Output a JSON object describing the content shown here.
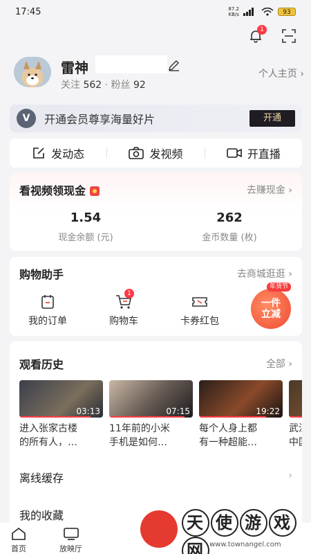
{
  "status": {
    "time": "17:45",
    "netspeed_value": "87.2",
    "netspeed_unit": "KB/s",
    "battery": "93"
  },
  "top": {
    "bell_badge": "1"
  },
  "profile": {
    "name": "雷神",
    "follow_label": "关注",
    "follow_count": "562",
    "fans_label": "粉丝",
    "fans_count": "92",
    "homepage_link": "个人主页 ›"
  },
  "vip": {
    "logo": "V",
    "text": "开通会员尊享海量好片",
    "button": "开通"
  },
  "actions": [
    {
      "label": "发动态",
      "icon": "edit-square-icon"
    },
    {
      "label": "发视频",
      "icon": "camera-icon"
    },
    {
      "label": "开直播",
      "icon": "video-camera-icon"
    }
  ],
  "cash": {
    "title": "看视频领现金",
    "link": "去赚现金 ›",
    "balance_value": "1.54",
    "balance_label": "现金余额 (元)",
    "coins_value": "262",
    "coins_label": "金币数量 (枚)"
  },
  "shop": {
    "title": "购物助手",
    "link": "去商城逛逛 ›",
    "items": [
      {
        "label": "我的订单",
        "icon": "order-icon"
      },
      {
        "label": "购物车",
        "icon": "cart-icon",
        "badge": "1"
      },
      {
        "label": "卡券红包",
        "icon": "coupon-icon"
      }
    ],
    "promo_tag": "年货节",
    "promo_line1": "一件",
    "promo_line2": "立减"
  },
  "history": {
    "title": "观看历史",
    "link": "全部 ›",
    "videos": [
      {
        "title_line1": "进入张家古楼",
        "title_line2": "的所有人，…",
        "duration": "03:13",
        "progress": 0.85
      },
      {
        "title_line1": "11年前的小米",
        "title_line2": "手机是如何…",
        "duration": "07:15",
        "progress": 0.9
      },
      {
        "title_line1": "每个人身上都",
        "title_line2": "有一种超能…",
        "duration": "19:22",
        "progress": 0.8
      },
      {
        "title_line1": "武汉",
        "title_line2": "中国",
        "duration": "",
        "progress": 0.5
      }
    ]
  },
  "offline": {
    "label": "离线缓存",
    "chev": "›"
  },
  "favorites": {
    "label": "我的收藏"
  },
  "nav": [
    {
      "label": "首页",
      "icon": "home-icon"
    },
    {
      "label": "放映厅",
      "icon": "tv-icon"
    }
  ],
  "watermark": {
    "chars": [
      "天",
      "使",
      "游",
      "戏",
      "网"
    ],
    "url": "www.townangel.com"
  },
  "colors": {
    "accent": "#ff3a47",
    "vip_button_bg": "#1f1c23",
    "vip_button_text": "#f4d6a8"
  }
}
